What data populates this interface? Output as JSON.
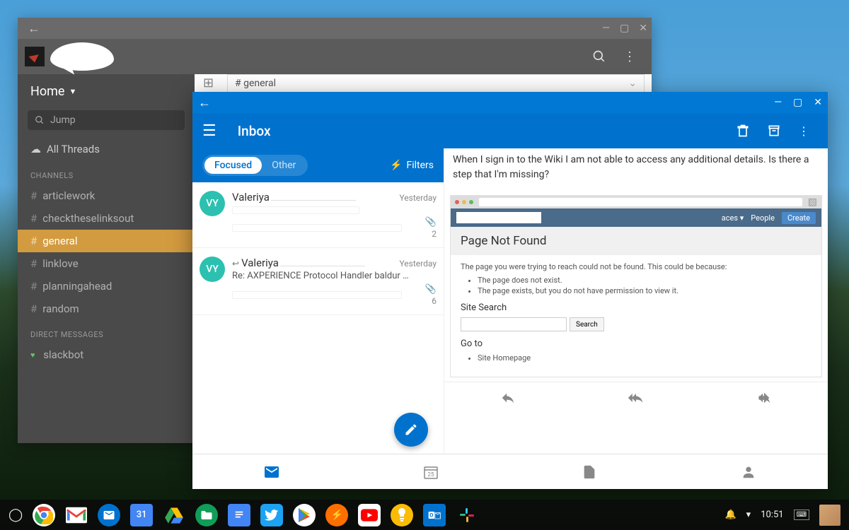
{
  "slack": {
    "home_label": "Home",
    "jump_placeholder": "Jump",
    "all_threads": "All Threads",
    "channels_header": "CHANNELS",
    "channels": [
      {
        "name": "articlework",
        "active": false
      },
      {
        "name": "checktheselinksout",
        "active": false
      },
      {
        "name": "general",
        "active": true
      },
      {
        "name": "linklove",
        "active": false
      },
      {
        "name": "planningahead",
        "active": false
      },
      {
        "name": "random",
        "active": false
      }
    ],
    "dm_header": "DIRECT MESSAGES",
    "dms": [
      {
        "name": "slackbot"
      }
    ],
    "channel_dropdown": "# general"
  },
  "outlook": {
    "title": "Inbox",
    "tabs": {
      "focused": "Focused",
      "other": "Other"
    },
    "filters_label": "Filters",
    "messages": [
      {
        "initials": "VY",
        "sender": "Valeriya",
        "date": "Yesterday",
        "subject": "",
        "count": "2",
        "has_attachment": true,
        "is_reply": false
      },
      {
        "initials": "VY",
        "sender": "Valeriya",
        "date": "Yesterday",
        "subject": "Re: AXPERIENCE Protocol Handler baldur …",
        "count": "6",
        "has_attachment": true,
        "is_reply": true
      }
    ],
    "reading": {
      "body_text": "When I sign in to the Wiki I am not able to access any additional details. Is there a step that I'm missing?",
      "embedded": {
        "menu_items": {
          "aces": "aces ▾",
          "people": "People",
          "create": "Create"
        },
        "page_title": "Page Not Found",
        "not_found_text": "The page you were trying to reach could not be found. This could be because:",
        "reasons": [
          "The page does not exist.",
          "The page exists, but you do not have permission to view it."
        ],
        "site_search_label": "Site Search",
        "search_btn": "Search",
        "goto_label": "Go to",
        "goto_items": [
          "Site Homepage"
        ]
      }
    },
    "nav": {
      "calendar_day": "25"
    }
  },
  "taskbar": {
    "time": "10:51"
  }
}
